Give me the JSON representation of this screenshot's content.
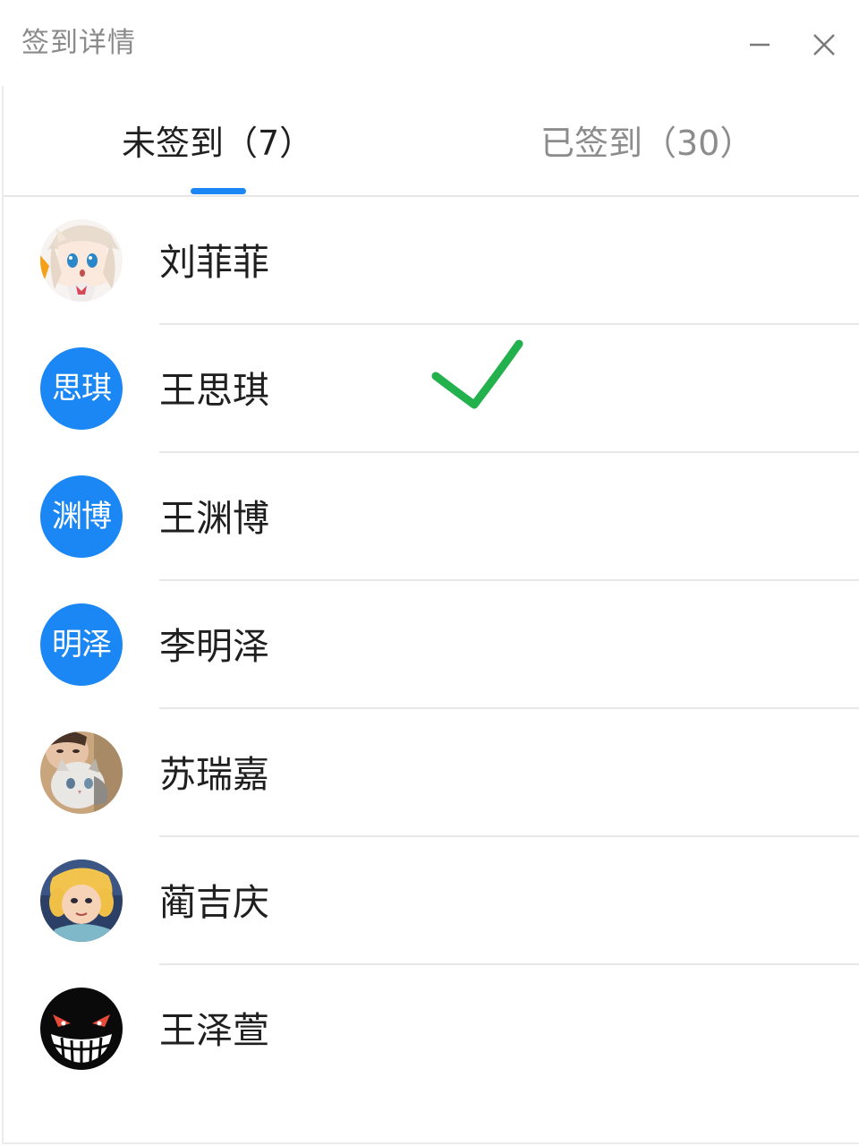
{
  "window": {
    "title": "签到详情",
    "minimize_icon": "minimize-icon",
    "close_icon": "close-icon"
  },
  "tabs": [
    {
      "label": "未签到（7）",
      "active": true
    },
    {
      "label": "已签到（30）",
      "active": false
    }
  ],
  "accent_color": "#1b87f5",
  "check_color": "#22b14c",
  "members": [
    {
      "name": "刘菲菲",
      "avatar_type": "image",
      "avatar_text": "",
      "avatar_desc": "anime-girl-avatar"
    },
    {
      "name": "王思琪",
      "avatar_type": "text",
      "avatar_text": "思琪",
      "checked": true
    },
    {
      "name": "王渊博",
      "avatar_type": "text",
      "avatar_text": "渊博"
    },
    {
      "name": "李明泽",
      "avatar_type": "text",
      "avatar_text": "明泽"
    },
    {
      "name": "苏瑞嘉",
      "avatar_type": "image",
      "avatar_text": "",
      "avatar_desc": "cat-photo-avatar"
    },
    {
      "name": "蔺吉庆",
      "avatar_type": "image",
      "avatar_text": "",
      "avatar_desc": "cartoon-girl-avatar"
    },
    {
      "name": "王泽萱",
      "avatar_type": "image",
      "avatar_text": "",
      "avatar_desc": "grinning-face-avatar"
    }
  ]
}
